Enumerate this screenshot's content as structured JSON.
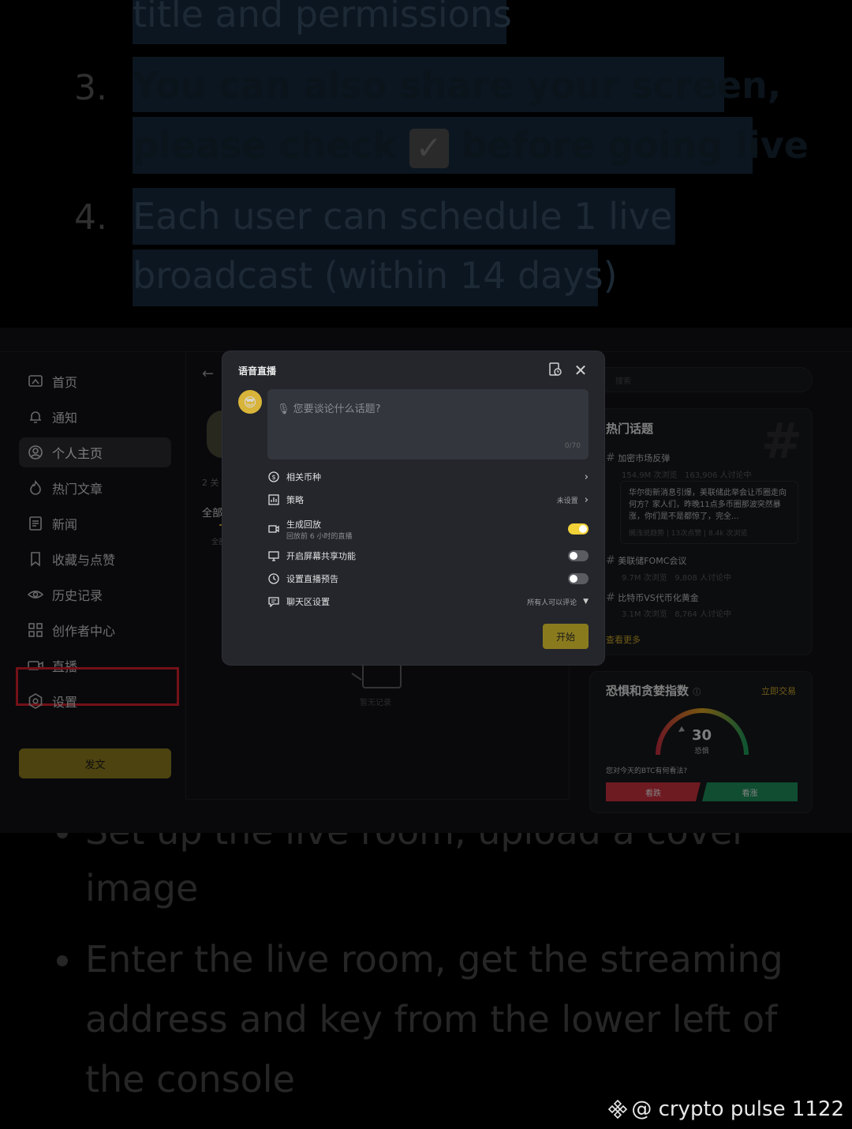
{
  "article_top": {
    "line0": "title and permissions",
    "item3_number": "3.",
    "item3_line1": "You can also share your screen,",
    "item3_line2a": "please check",
    "item3_check": "✓",
    "item3_line2b": "before going live",
    "item4_number": "4.",
    "item4_line1": "Each user can schedule 1 live",
    "item4_line2": "broadcast (within 14 days)"
  },
  "sidebar": {
    "items": [
      {
        "label": "首页",
        "icon": "home-icon"
      },
      {
        "label": "通知",
        "icon": "bell-icon"
      },
      {
        "label": "个人主页",
        "icon": "profile-icon"
      },
      {
        "label": "热门文章",
        "icon": "fire-icon"
      },
      {
        "label": "新闻",
        "icon": "news-icon"
      },
      {
        "label": "收藏与点赞",
        "icon": "bookmark-icon"
      },
      {
        "label": "历史记录",
        "icon": "eye-icon"
      },
      {
        "label": "创作者中心",
        "icon": "grid-icon"
      },
      {
        "label": "直播",
        "icon": "camera-icon"
      },
      {
        "label": "设置",
        "icon": "settings-icon"
      }
    ],
    "post_button": "发文"
  },
  "middle": {
    "back": "←",
    "follow_count": "2 关",
    "tab_all": "全部",
    "tab_all_sub": "全部",
    "empty": "暂无记录"
  },
  "right": {
    "search_placeholder": "搜索",
    "hot_topics": {
      "title": "热门话题",
      "topic1": {
        "name": "加密市场反弹",
        "views": "154.9M 次浏览",
        "discuss": "163,906 人讨论中"
      },
      "quote": {
        "text": "华尔街新消息引爆，美联储此举会让币圈走向何方？家人们，昨晚11点多币圈那波突然暴涨，你们是不是都惊了，完全...",
        "meta": "搁浅说趋势 | 13次点赞 | 8.4k 次浏览"
      },
      "topic2": {
        "name": "美联储FOMC会议",
        "views": "9.7M 次浏览",
        "discuss": "9,808 人讨论中"
      },
      "topic3": {
        "name": "比特币VS代币化黄金",
        "views": "3.1M 次浏览",
        "discuss": "8,764 人讨论中"
      },
      "more": "查看更多"
    },
    "fear_greed": {
      "title": "恐惧和贪婪指数",
      "trade_link": "立即交易",
      "value": "30",
      "label": "恐惧",
      "question": "您对今天的BTC有何看法?",
      "bear": "看跌",
      "bull": "看涨"
    }
  },
  "dialog": {
    "title": "语音直播",
    "topic_placeholder": "您要谈论什么话题?",
    "counter": "0/70",
    "options": {
      "coin": "相关币种",
      "strategy": "策略",
      "strategy_value": "未设置",
      "replay": "生成回放",
      "replay_sub": "回放前 6 小时的直播",
      "replay_on": true,
      "screen_share": "开启屏幕共享功能",
      "screen_share_on": false,
      "schedule": "设置直播预告",
      "schedule_on": false,
      "chat": "聊天区设置",
      "chat_value": "所有人可以评论"
    },
    "start": "开始"
  },
  "article_bottom": {
    "bullet1_line1": "Set up the live room, upload a cover",
    "bullet1_line2": "image",
    "bullet2_line1": "Enter the live room, get the streaming",
    "bullet2_line2": "address and key from the lower left of",
    "bullet2_line3": "the console"
  },
  "watermark": "@ crypto pulse 1122",
  "colors": {
    "accent_yellow": "#8a7a1e",
    "toggle_on": "#f0d138",
    "highlight_red": "#d2202c",
    "bear_red": "#c8303c",
    "bull_green": "#1e8c5a"
  }
}
